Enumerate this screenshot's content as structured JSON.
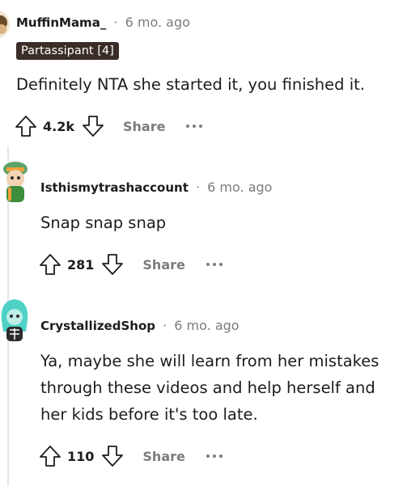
{
  "comments": [
    {
      "username": "MuffinMama_",
      "separator": "·",
      "age": "6 mo. ago",
      "flair": "Partassipant [4]",
      "body": "Definitely NTA she started it, you finished it.",
      "score": "4.2k",
      "share_label": "Share",
      "avatar_icon": "avatar-muffin-icon"
    },
    {
      "username": "Isthismytrashaccount",
      "separator": "·",
      "age": "6 mo. ago",
      "body": "Snap snap snap",
      "score": "281",
      "share_label": "Share",
      "avatar_icon": "avatar-green-hat-icon"
    },
    {
      "username": "CrystallizedShop",
      "separator": "·",
      "age": "6 mo. ago",
      "body_lines": [
        "Ya, maybe she will learn from her mistakes",
        "through these videos and help herself and",
        "her kids before it's too late."
      ],
      "score": "110",
      "share_label": "Share",
      "avatar_icon": "avatar-teal-hair-icon"
    }
  ],
  "icons": {
    "upvote": "upvote-arrow-icon",
    "downvote": "downvote-arrow-icon",
    "more": "more-options-icon"
  },
  "colors": {
    "flair_bg": "#3a2d27",
    "meta_gray": "#7c7c7c",
    "thread_line": "#e4e6e8"
  }
}
